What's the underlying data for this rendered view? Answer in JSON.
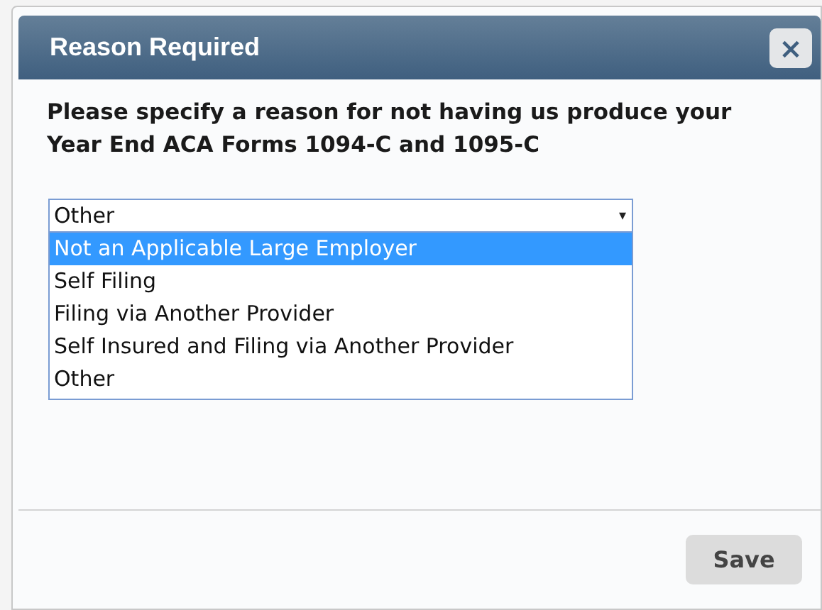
{
  "dialog": {
    "title": "Reason Required",
    "close": "×",
    "prompt": "Please specify a reason for not having us produce your Year End ACA Forms 1094-C and 1095-C"
  },
  "select": {
    "value": "Other",
    "caret": "▾",
    "expanded": true,
    "options": [
      {
        "label": "Not an Applicable Large Employer",
        "highlighted": true
      },
      {
        "label": "Self Filing",
        "highlighted": false
      },
      {
        "label": "Filing via Another Provider",
        "highlighted": false
      },
      {
        "label": "Self Insured and Filing via Another Provider",
        "highlighted": false
      },
      {
        "label": "Other",
        "highlighted": false
      }
    ]
  },
  "buttons": [
    {
      "label": "Save"
    }
  ]
}
